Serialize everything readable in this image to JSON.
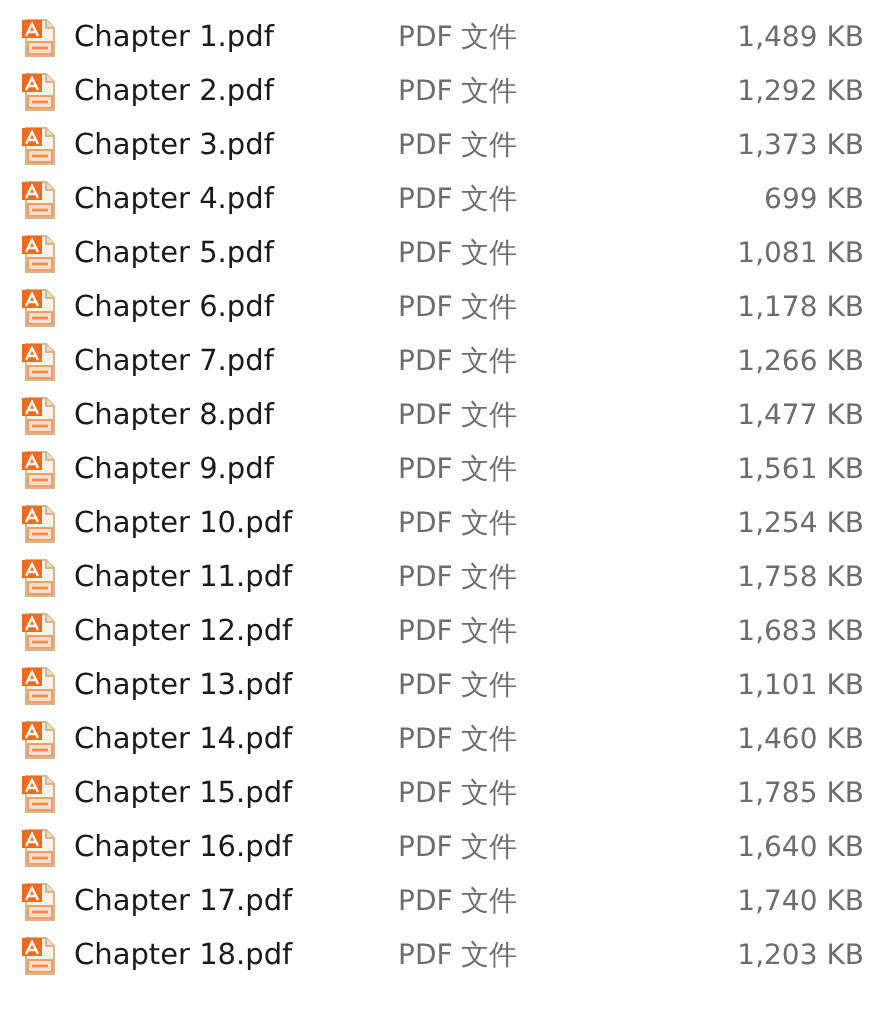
{
  "files": [
    {
      "name": "Chapter 1.pdf",
      "type": "PDF 文件",
      "size": "1,489 KB"
    },
    {
      "name": "Chapter 2.pdf",
      "type": "PDF 文件",
      "size": "1,292 KB"
    },
    {
      "name": "Chapter 3.pdf",
      "type": "PDF 文件",
      "size": "1,373 KB"
    },
    {
      "name": "Chapter 4.pdf",
      "type": "PDF 文件",
      "size": "699 KB"
    },
    {
      "name": "Chapter 5.pdf",
      "type": "PDF 文件",
      "size": "1,081 KB"
    },
    {
      "name": "Chapter 6.pdf",
      "type": "PDF 文件",
      "size": "1,178 KB"
    },
    {
      "name": "Chapter 7.pdf",
      "type": "PDF 文件",
      "size": "1,266 KB"
    },
    {
      "name": "Chapter 8.pdf",
      "type": "PDF 文件",
      "size": "1,477 KB"
    },
    {
      "name": "Chapter 9.pdf",
      "type": "PDF 文件",
      "size": "1,561 KB"
    },
    {
      "name": "Chapter 10.pdf",
      "type": "PDF 文件",
      "size": "1,254 KB"
    },
    {
      "name": "Chapter 11.pdf",
      "type": "PDF 文件",
      "size": "1,758 KB"
    },
    {
      "name": "Chapter 12.pdf",
      "type": "PDF 文件",
      "size": "1,683 KB"
    },
    {
      "name": "Chapter 13.pdf",
      "type": "PDF 文件",
      "size": "1,101 KB"
    },
    {
      "name": "Chapter 14.pdf",
      "type": "PDF 文件",
      "size": "1,460 KB"
    },
    {
      "name": "Chapter 15.pdf",
      "type": "PDF 文件",
      "size": "1,785 KB"
    },
    {
      "name": "Chapter 16.pdf",
      "type": "PDF 文件",
      "size": "1,640 KB"
    },
    {
      "name": "Chapter 17.pdf",
      "type": "PDF 文件",
      "size": "1,740 KB"
    },
    {
      "name": "Chapter 18.pdf",
      "type": "PDF 文件",
      "size": "1,203 KB"
    }
  ]
}
